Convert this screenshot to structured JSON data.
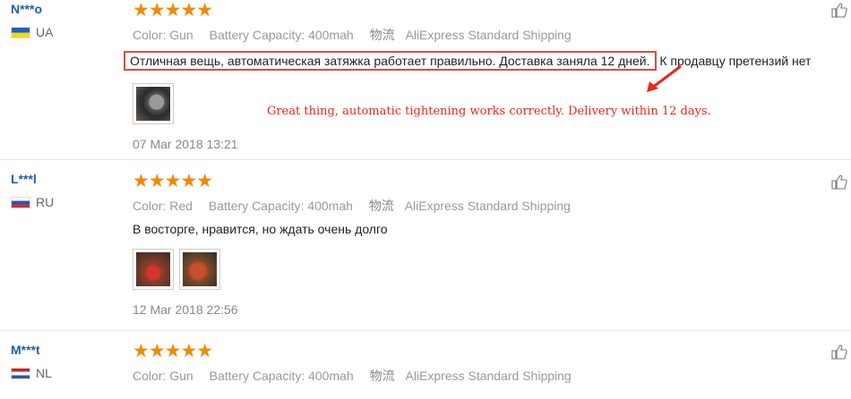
{
  "reviews": [
    {
      "username": "N***o",
      "country": "UA",
      "stars": "★★★★★",
      "color_label": "Color:",
      "color_value": "Gun",
      "battery_label": "Battery Capacity:",
      "battery_value": "400mah",
      "shipping_label": "物流",
      "shipping_value": "AliExpress Standard Shipping",
      "text_highlight": "Отличная вещь, автоматическая затяжка работает правильно. Доставка заняла 12 дней.",
      "text_rest": " К продавцу претензий нет",
      "date": "07 Mar 2018 13:21"
    },
    {
      "username": "L***l",
      "country": "RU",
      "stars": "★★★★★",
      "color_label": "Color:",
      "color_value": "Red",
      "battery_label": "Battery Capacity:",
      "battery_value": "400mah",
      "shipping_label": "物流",
      "shipping_value": "AliExpress Standard Shipping",
      "text": "В восторге, нравится, но ждать очень долго",
      "date": "12 Mar 2018 22:56"
    },
    {
      "username": "M***t",
      "country": "NL",
      "stars": "★★★★★",
      "color_label": "Color:",
      "color_value": "Gun",
      "battery_label": "Battery Capacity:",
      "battery_value": "400mah",
      "shipping_label": "物流",
      "shipping_value": "AliExpress Standard Shipping"
    }
  ],
  "annotation": "Great thing, automatic tightening works correctly. Delivery within 12 days.",
  "colors": {
    "stars": "#f08a00",
    "username": "#1f5fa8",
    "annotation": "#e8261c"
  },
  "icons": {
    "like": "thumbs-up-icon",
    "arrow": "arrow-icon"
  }
}
